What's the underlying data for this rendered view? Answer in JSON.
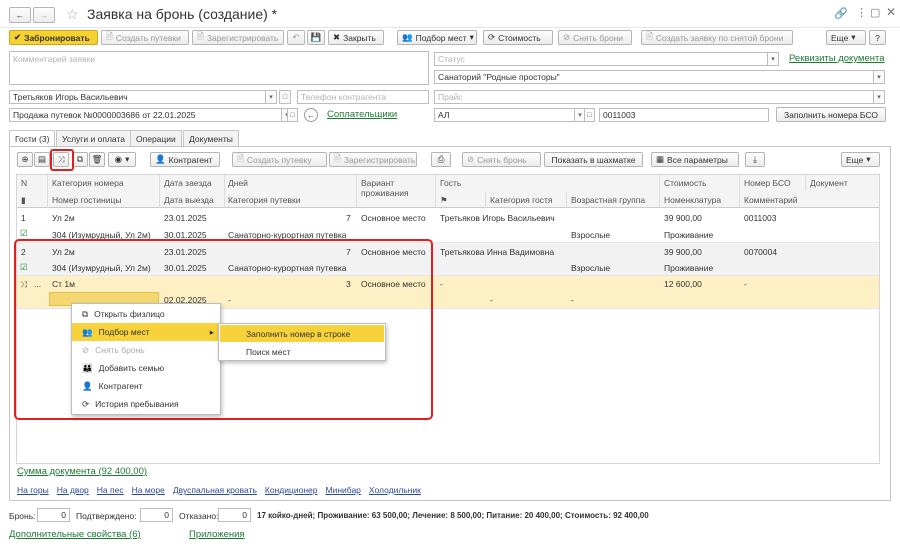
{
  "window": {
    "title": "Заявка на бронь (создание) *"
  },
  "toolbar": {
    "book": "Забронировать",
    "create_voucher": "Создать путевки",
    "register": "Зарегистрировать",
    "close": "Закрыть",
    "pick_places": "Подбор мест",
    "cost": "Стоимость",
    "cancel_booking": "Снять брони",
    "create_from_cancelled": "Создать заявку по снятой брони",
    "more": "Еще",
    "help": "?"
  },
  "form": {
    "comment_ph": "Комментарий заявки",
    "status_ph": "Статус",
    "requisites_link": "Реквизиты документа",
    "sanatorium": "Санаторий \"Родные просторы\"",
    "client": "Третьяков Игорь Васильевич",
    "phone_ph": "Телефон контрагента",
    "price_ph": "Прайс",
    "sale": "Продажа путевок №0000003686 от 22.01.2025",
    "payers_link": "Соплательщики",
    "code_al": "АЛ",
    "code_num": "0011003",
    "fill_bso": "Заполнить номера БСО"
  },
  "tabs": [
    "Гости (3)",
    "Услуги и оплата",
    "Операции",
    "Документы"
  ],
  "grid_toolbar": {
    "contractor": "Контрагент",
    "create_voucher": "Создать путевку",
    "register": "Зарегистрировать",
    "cancel_booking": "Снять бронь",
    "show_chess": "Показать в шахматке",
    "all_params": "Все параметры",
    "more": "Еще"
  },
  "columns": {
    "n": "N",
    "cat": "Категория номера",
    "room": "Номер гостиницы",
    "date_in": "Дата заезда",
    "date_out": "Дата выезда",
    "days": "Дней",
    "voucher_cat": "Категория путевки",
    "variant": "Вариант проживания",
    "guest": "Гость",
    "guest_cat": "Категория гостя",
    "age_group": "Возрастная группа",
    "cost": "Стоимость",
    "nomenclature": "Номенклатура",
    "bso": "Номер БСО",
    "comment": "Комментарий",
    "doc": "Документ"
  },
  "rows": [
    {
      "n": "1",
      "cat": "Ул 2м",
      "room": "304 (Изумрудный, Ул 2м)",
      "date_in": "23.01.2025",
      "date_out": "30.01.2025",
      "days": "7",
      "voucher_cat": "Санаторно-курортная путевка",
      "variant": "Основное место",
      "guest": "Третьяков Игорь Васильевич",
      "age": "Взрослые",
      "cost": "39 900,00",
      "nom": "Проживание",
      "bso": "0011003"
    },
    {
      "n": "2",
      "cat": "Ул 2м",
      "room": "304 (Изумрудный, Ул 2м)",
      "date_in": "23.01.2025",
      "date_out": "30.01.2025",
      "days": "7",
      "voucher_cat": "Санаторно-курортная путевка",
      "variant": "Основное место",
      "guest": "Третьякова Инна Вадимовна",
      "age": "Взрослые",
      "cost": "39 900,00",
      "nom": "Проживание",
      "bso": "0070004"
    },
    {
      "n": "...",
      "cat": "Ст 1м",
      "date_out": "02.02.2025",
      "days": "3",
      "voucher_cat": "-",
      "variant": "Основное место",
      "guest": "-",
      "guest_cat": "-",
      "age": "-",
      "cost": "12 600,00",
      "bso": "-"
    }
  ],
  "context_menu": [
    "Открыть физлицо",
    "Подбор мест",
    "Снять бронь",
    "Добавить семью",
    "Контрагент",
    "История пребывания"
  ],
  "submenu": [
    "Заполнить номер в строке",
    "Поиск мест"
  ],
  "footer": {
    "sum_link": "Сумма документа (92 400,00)",
    "tags": [
      "На горы",
      "На двор",
      "На пес",
      "На море",
      "Двуспальная кровать",
      "Кондиционер",
      "Минибар",
      "Холодильник"
    ],
    "bron_label": "Бронь:",
    "bron_val": "0",
    "confirmed_label": "Подтверждено:",
    "confirmed_val": "0",
    "refused_label": "Отказано:",
    "refused_val": "0",
    "summary": "17 койко-дней; Проживание: 63 500,00; Лечение: 8 500,00; Питание: 20 400,00; Стоимость: 92 400,00",
    "extra_props": "Дополнительные свойства (6)",
    "attachments": "Приложения"
  },
  "colors": {
    "accent": "#f5d22f",
    "highlight": "#e02020",
    "link": "#1e7a33",
    "row_selected": "#fcf0c4"
  }
}
